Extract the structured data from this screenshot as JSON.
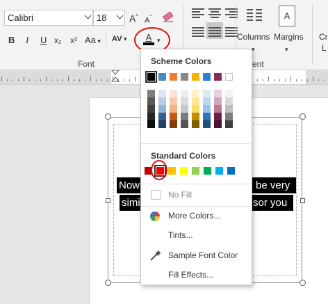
{
  "ribbon": {
    "font_name": "Calibri",
    "font_size": "18",
    "grow_font_label": "A",
    "shrink_font_label": "A",
    "bold_label": "B",
    "italic_label": "I",
    "underline_label": "U",
    "subscript_label": "x₂",
    "superscript_label": "x²",
    "change_case_label": "Aa",
    "char_spacing_label": "AV",
    "font_color_label": "A",
    "font_group_label": "Font",
    "paragraph_group_label_partial": "ent",
    "columns_label": "Columns",
    "margins_label": "Margins",
    "cut_label_top": "Cr",
    "cut_label_bottom": "L"
  },
  "document": {
    "line1_left": "Now",
    "line1_right": "be very",
    "line2_left": "simi",
    "line2_right": "sor you"
  },
  "menu": {
    "scheme_header": "Scheme Colors",
    "standard_header": "Standard Colors",
    "no_fill": "No Fill",
    "more_colors": "More Colors...",
    "tints": "Tints...",
    "sample_font_color": "Sample Font Color",
    "fill_effects": "Fill Effects...",
    "scheme_top_row": [
      "#000000",
      "#4a86c8",
      "#ed7d31",
      "#888888",
      "#f0b400",
      "#2f7fd4",
      "#8b2c56",
      "#ffffff"
    ],
    "scheme_columns": [
      [
        "#7f7f7f",
        "#595959",
        "#3f3f3f",
        "#262626",
        "#0d0d0d"
      ],
      [
        "#dce6f2",
        "#b8cce4",
        "#95b3d7",
        "#366092",
        "#244062"
      ],
      [
        "#fbe5d6",
        "#f8cbad",
        "#f4b183",
        "#c55a11",
        "#843c0c"
      ],
      [
        "#ededed",
        "#dbdbdb",
        "#c9c9c9",
        "#7b7b7b",
        "#525252"
      ],
      [
        "#fff2cc",
        "#ffe699",
        "#ffd966",
        "#bf9000",
        "#7f6000"
      ],
      [
        "#ddebf7",
        "#bdd7ee",
        "#9bc2e6",
        "#2f75b5",
        "#1f4e78"
      ],
      [
        "#e8d1dc",
        "#d3a5b9",
        "#bd7a96",
        "#6b2142",
        "#47162c"
      ],
      [
        "#f2f2f2",
        "#d9d9d9",
        "#bfbfbf",
        "#7f7f7f",
        "#404040"
      ]
    ],
    "standard_colors": [
      "#c00000",
      "#ff0000",
      "#ffc000",
      "#ffff00",
      "#92d050",
      "#00b050",
      "#00b0f0",
      "#0070c0"
    ],
    "selected_scheme_index": 0,
    "selected_standard_index": 1
  }
}
